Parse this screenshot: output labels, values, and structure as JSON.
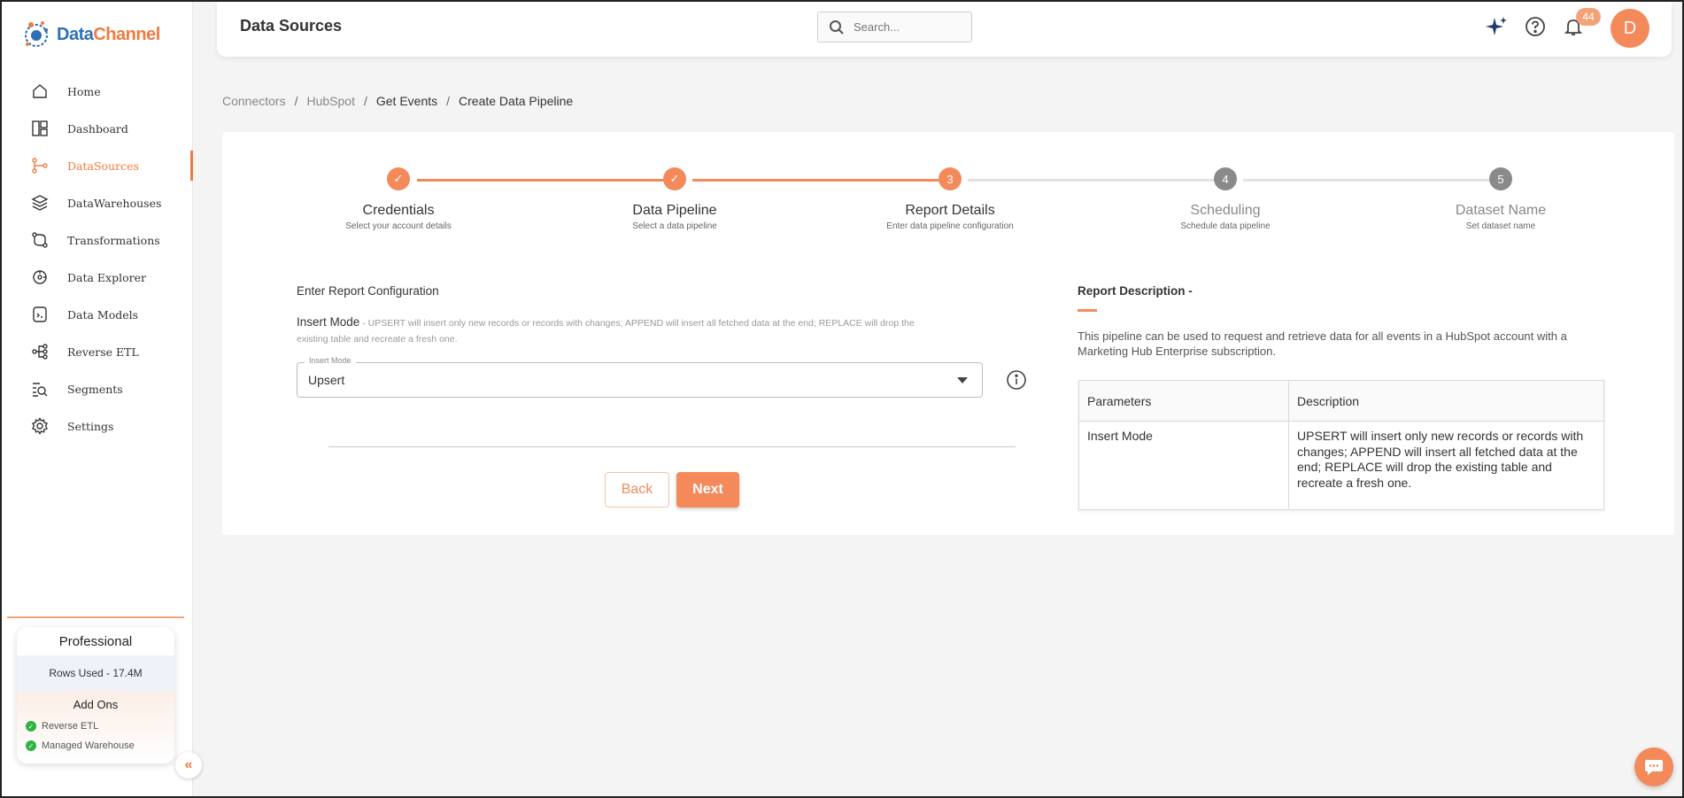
{
  "app": {
    "brand_part1": "Data",
    "brand_part2": "Channel",
    "accent": "#f4895a",
    "brand_blue": "#2e6fb5"
  },
  "sidebar": {
    "items": [
      {
        "label": "Home",
        "icon": "home-icon"
      },
      {
        "label": "Dashboard",
        "icon": "dashboard-icon"
      },
      {
        "label": "DataSources",
        "icon": "datasources-icon",
        "active": true
      },
      {
        "label": "DataWarehouses",
        "icon": "layers-icon"
      },
      {
        "label": "Transformations",
        "icon": "transform-icon"
      },
      {
        "label": "Data Explorer",
        "icon": "explorer-icon"
      },
      {
        "label": "Data Models",
        "icon": "models-icon"
      },
      {
        "label": "Reverse ETL",
        "icon": "reverse-etl-icon"
      },
      {
        "label": "Segments",
        "icon": "segments-icon"
      },
      {
        "label": "Settings",
        "icon": "gear-icon"
      }
    ],
    "plan": {
      "name": "Professional",
      "rows_used": "Rows Used - 17.4M",
      "addons_title": "Add Ons",
      "addons": [
        "Reverse ETL",
        "Managed Warehouse"
      ]
    }
  },
  "header": {
    "title": "Data Sources",
    "search_placeholder": "Search...",
    "notification_count": "44",
    "avatar_initial": "D"
  },
  "breadcrumb": [
    "Connectors",
    "HubSpot",
    "Get Events",
    "Create Data Pipeline"
  ],
  "stepper": {
    "steps": [
      {
        "title": "Credentials",
        "subtitle": "Select your account details",
        "state": "done"
      },
      {
        "title": "Data Pipeline",
        "subtitle": "Select a data pipeline",
        "state": "done"
      },
      {
        "title": "Report Details",
        "subtitle": "Enter data pipeline configuration",
        "state": "current",
        "number": "3"
      },
      {
        "title": "Scheduling",
        "subtitle": "Schedule data pipeline",
        "state": "todo",
        "number": "4"
      },
      {
        "title": "Dataset Name",
        "subtitle": "Set dataset name",
        "state": "todo",
        "number": "5"
      }
    ]
  },
  "form": {
    "heading": "Enter Report Configuration",
    "mode_label": "Insert Mode",
    "mode_help": "- UPSERT will insert only new records or records with changes; APPEND will insert all fetched data at the end; REPLACE will drop the existing table and recreate a fresh one.",
    "select_float_label": "Insert Mode",
    "select_value": "Upsert",
    "back_label": "Back",
    "next_label": "Next"
  },
  "description": {
    "heading": "Report Description -",
    "text": "This pipeline can be used to request and retrieve data for all events in a HubSpot account with a Marketing Hub Enterprise subscription.",
    "table": {
      "headers": [
        "Parameters",
        "Description"
      ],
      "rows": [
        [
          "Insert Mode",
          "UPSERT will insert only new records or records with changes; APPEND will insert all fetched data at the end; REPLACE will drop the existing table and recreate a fresh one."
        ]
      ]
    }
  }
}
